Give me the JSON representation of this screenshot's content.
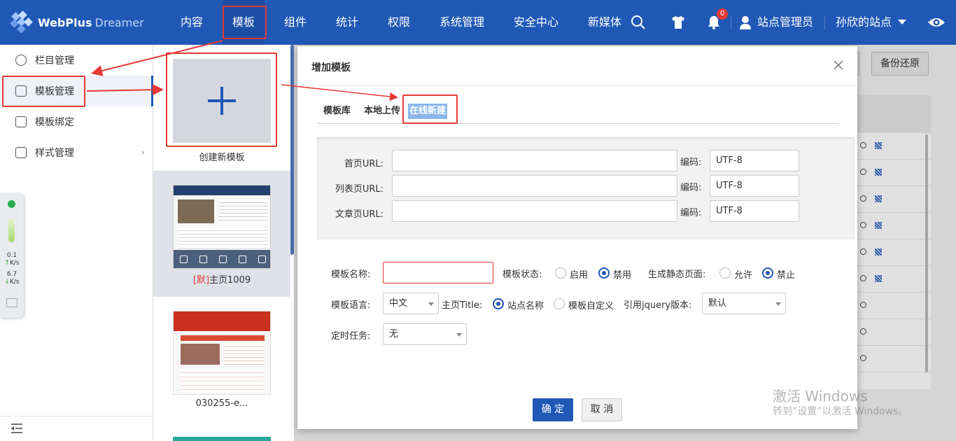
{
  "header": {
    "logo_brand": "WebPlus",
    "logo_sub": "Dreamer",
    "nav": [
      "内容",
      "模板",
      "组件",
      "统计",
      "权限",
      "系统管理",
      "安全中心",
      "新媒体"
    ],
    "active_nav": "模板",
    "notification_count": "0",
    "user_name": "站点管理员",
    "site_name": "孙欣的站点"
  },
  "sidebar": {
    "items": [
      {
        "label": "栏目管理",
        "icon": "column-icon"
      },
      {
        "label": "模板管理",
        "icon": "template-icon",
        "active": true
      },
      {
        "label": "模板绑定",
        "icon": "binding-icon"
      },
      {
        "label": "样式管理",
        "icon": "style-icon"
      }
    ]
  },
  "widget": {
    "up_speed": "0.1",
    "up_unit": "K/s",
    "down_speed": "6.7",
    "down_unit": "K/s"
  },
  "templates": {
    "create_label": "创建新模板",
    "items": [
      {
        "default_tag": "[默]",
        "name": "主页1009"
      },
      {
        "default_tag": "",
        "name": "030255-e..."
      }
    ]
  },
  "background": {
    "backup_button": "备份还原"
  },
  "modal": {
    "title": "增加模板",
    "tabs": [
      "模板库",
      "本地上传",
      "在线新建"
    ],
    "active_tab": "在线新建",
    "urls": [
      {
        "label": "首页URL:",
        "value": "",
        "encoding_label": "编码:",
        "encoding": "UTF-8"
      },
      {
        "label": "列表页URL:",
        "value": "",
        "encoding_label": "编码:",
        "encoding": "UTF-8"
      },
      {
        "label": "文章页URL:",
        "value": "",
        "encoding_label": "编码:",
        "encoding": "UTF-8"
      }
    ],
    "form": {
      "name_label": "模板名称:",
      "name_value": "",
      "status_label": "模板状态:",
      "status_options": [
        "启用",
        "禁用"
      ],
      "status_selected": "禁用",
      "static_label": "生成静态页面:",
      "static_options": [
        "允许",
        "禁止"
      ],
      "static_selected": "禁止",
      "lang_label": "模板语言:",
      "lang_value": "中文",
      "title_label": "主页Title:",
      "title_options": [
        "站点名称",
        "模板自定义"
      ],
      "title_selected": "站点名称",
      "jquery_label": "引用jquery版本:",
      "jquery_value": "默认",
      "task_label": "定时任务:",
      "task_value": "无"
    },
    "ok_button": "确 定",
    "cancel_button": "取 消"
  },
  "watermark": {
    "line1": "激活 Windows",
    "line2": "转到“设置”以激活 Windows。"
  },
  "colors": {
    "header_bg": "#2058b5",
    "primary": "#2058b5",
    "annotation": "#e53935",
    "active_tab_bg": "#8ab6ea"
  }
}
